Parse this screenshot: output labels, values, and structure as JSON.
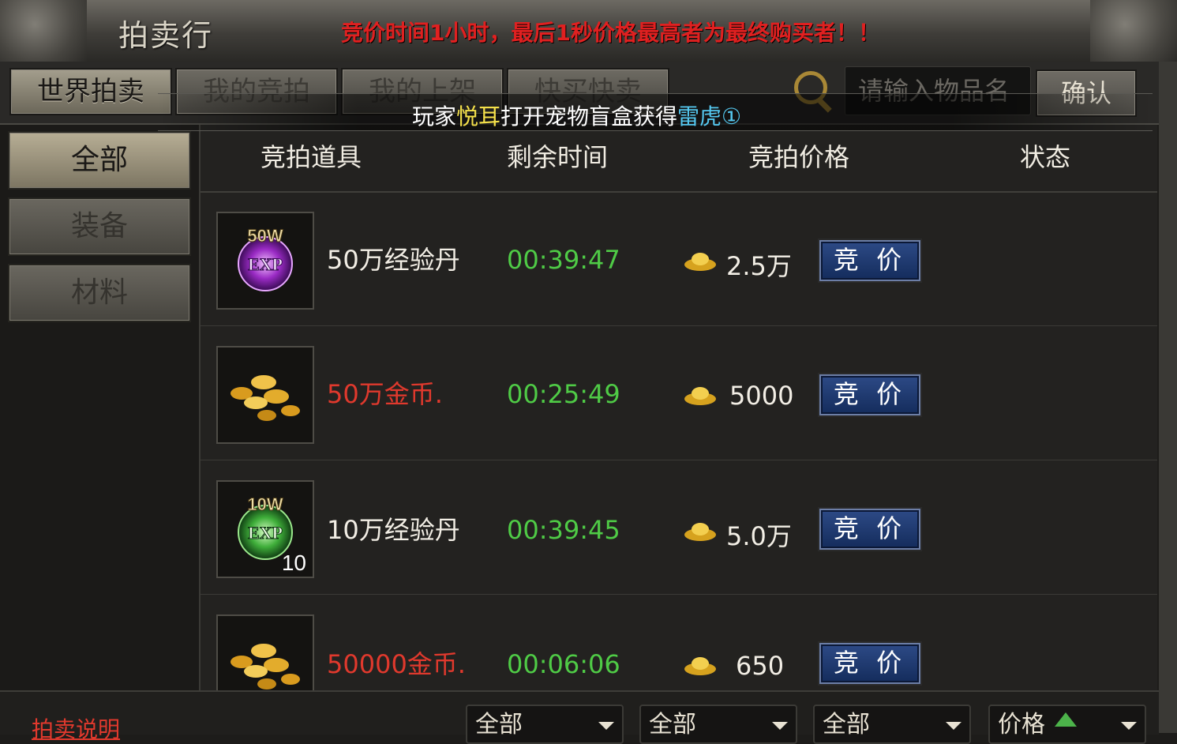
{
  "window": {
    "title": "拍卖行",
    "notice": "竞价时间1小时，最后1秒价格最高者为最终购买者！！"
  },
  "tabs": [
    {
      "label": "世界拍卖",
      "active": true
    },
    {
      "label": "我的竞拍",
      "active": false
    },
    {
      "label": "我的上架",
      "active": false
    },
    {
      "label": "快买快卖",
      "active": false
    }
  ],
  "search": {
    "placeholder": "请输入物品名",
    "confirm_label": "确认"
  },
  "broadcast": {
    "prefix": "玩家",
    "player": "悦耳",
    "middle": "打开宠物盲盒获得",
    "reward": "雷虎①"
  },
  "categories": [
    {
      "label": "全部",
      "active": true
    },
    {
      "label": "装备",
      "active": false
    },
    {
      "label": "材料",
      "active": false
    }
  ],
  "columns": {
    "item": "竞拍道具",
    "time": "剩余时间",
    "price": "竞拍价格",
    "status": "状态"
  },
  "rows": [
    {
      "icon_badge": "50W",
      "icon_name": "exp-orb-purple-icon",
      "name": "50万经验丹",
      "name_color": "#f2eee5",
      "time": "00:39:47",
      "price": "2.5万",
      "bid_label": "竞 价",
      "qty": ""
    },
    {
      "icon_badge": "",
      "icon_name": "gold-coins-icon",
      "name": "50万金币.",
      "name_color": "#e0392d",
      "time": "00:25:49",
      "price": "5000",
      "bid_label": "竞 价",
      "qty": ""
    },
    {
      "icon_badge": "10W",
      "icon_name": "exp-orb-green-icon",
      "name": "10万经验丹",
      "name_color": "#f2eee5",
      "time": "00:39:45",
      "price": "5.0万",
      "bid_label": "竞 价",
      "qty": "10"
    },
    {
      "icon_badge": "",
      "icon_name": "gold-coins-icon",
      "name": "50000金币.",
      "name_color": "#e0392d",
      "time": "00:06:06",
      "price": "650",
      "bid_label": "竞 价",
      "qty": ""
    }
  ],
  "footer": {
    "explain_label": "拍卖说明",
    "filters": [
      "全部",
      "全部",
      "全部"
    ],
    "sort_label": "价格"
  },
  "colors": {
    "accent_red": "#e0392d",
    "time_green": "#4fcb46",
    "bid_blue": "#1f3a72"
  }
}
